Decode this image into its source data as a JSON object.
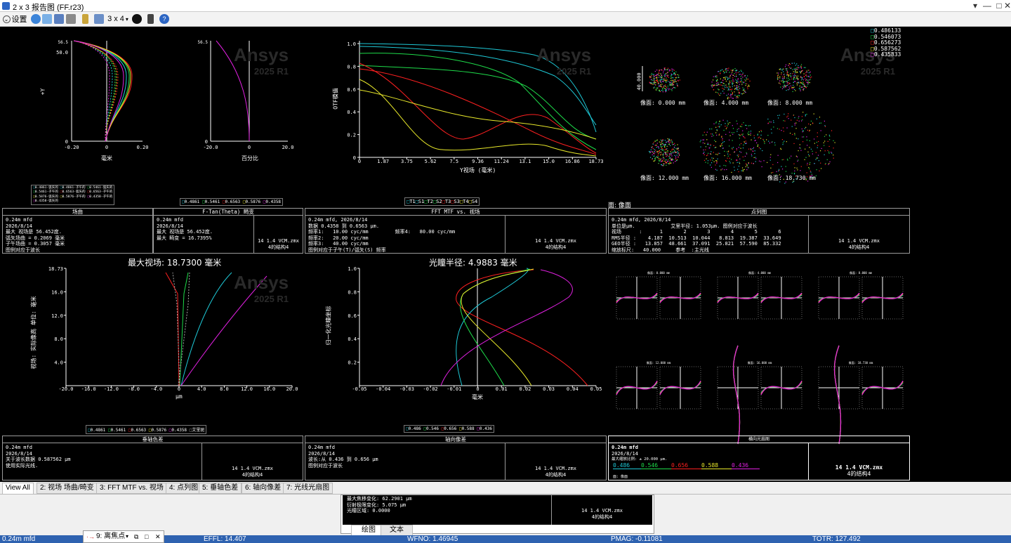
{
  "window": {
    "title": "2 x 3 报告图 (FF.r23)"
  },
  "toolbar": {
    "settings_label": "设置",
    "layout_label": "3 x 4"
  },
  "watermark": {
    "brand": "Ansys",
    "version": "2025 R1"
  },
  "chart_data": [
    {
      "type": "line",
      "title": "场曲",
      "xlabel": "毫米",
      "ylabel": "+Y",
      "x_ticks": [
        "-0.20",
        "0",
        "0.20"
      ],
      "y_ticks": [
        "0",
        "50.0",
        "56.5"
      ],
      "xlim": [
        -0.2,
        0.2
      ],
      "ylim": [
        0,
        56.5
      ],
      "series": [
        {
          "name": "0.4861-弧矢的",
          "color": "#1ec8d6"
        },
        {
          "name": "0.4861-子午的",
          "color": "#1ec8d6"
        },
        {
          "name": "0.5461-弧矢的",
          "color": "#1edc4a"
        },
        {
          "name": "0.5461-子午的",
          "color": "#1edc4a"
        },
        {
          "name": "0.6563-弧矢的",
          "color": "#ff2020"
        },
        {
          "name": "0.6563-子午的",
          "color": "#ff2020"
        },
        {
          "name": "0.5876-弧矢的",
          "color": "#e8e82a"
        },
        {
          "name": "0.5876-子午的",
          "color": "#e8e82a"
        },
        {
          "name": "0.4358-弧矢的",
          "color": "#e020e0"
        },
        {
          "name": "0.4358-子午的",
          "color": "#e020e0"
        }
      ]
    },
    {
      "type": "line",
      "title": "F-Tan(Theta) 畸变",
      "xlabel": "百分比",
      "x_ticks": [
        "-20.0",
        "0",
        "20.0"
      ],
      "y_ticks": [
        "0",
        "56.5"
      ],
      "xlim": [
        -20,
        20
      ],
      "ylim": [
        0,
        56.5
      ],
      "legend": [
        "0.4861",
        "0.5461",
        "0.6563",
        "0.5876",
        "0.4358"
      ]
    },
    {
      "type": "line",
      "title": "FFT MTF vs. 视场",
      "xlabel": "Y视场 (毫米)",
      "ylabel": "OTF模值",
      "x_ticks": [
        "0",
        "1.87",
        "3.75",
        "5.62",
        "7.5",
        "9.36",
        "11.24",
        "13.1",
        "15.0",
        "16.86",
        "18.73"
      ],
      "y_ticks": [
        "0",
        "0.2",
        "0.4",
        "0.6",
        "0.8",
        "1.0"
      ],
      "xlim": [
        0,
        18.73
      ],
      "ylim": [
        0,
        1.0
      ],
      "legend": [
        "T1",
        "S1",
        "T2",
        "S2",
        "T3",
        "S3",
        "T4",
        "S4"
      ]
    },
    {
      "type": "scatter",
      "title": "点列图",
      "wavelength_legend": [
        "0.486133",
        "0.546073",
        "0.656273",
        "0.587562",
        "0.435833"
      ],
      "scale_label": "40.000",
      "fields": [
        "像面: 0.000 mm",
        "像面: 4.000 mm",
        "像面: 8.000 mm",
        "像面: 12.000 mm",
        "像面: 16.000 mm",
        "像面: 18.730 mm"
      ]
    },
    {
      "type": "line",
      "title": "最大视场: 18.7300 毫米",
      "xlabel": "μm",
      "ylabel": "视场: 实际像高  单位: 毫米",
      "x_ticks": [
        "-20.0",
        "-16.0",
        "-12.0",
        "-8.0",
        "-4.0",
        "0",
        "4.0",
        "8.0",
        "12.0",
        "16.0",
        "20.0"
      ],
      "y_ticks": [
        "4.0",
        "8.0",
        "12.0",
        "16.0",
        "18.73"
      ],
      "xlim": [
        -20,
        20
      ],
      "ylim": [
        0,
        18.73
      ],
      "legend": [
        "0.4861",
        "0.5461",
        "0.6563",
        "0.5876",
        "0.4358",
        "艾里斑"
      ]
    },
    {
      "type": "line",
      "title": "光瞳半径: 4.9883 毫米",
      "xlabel": "毫米",
      "ylabel": "归一化光瞳坐标",
      "x_ticks": [
        "-0.05",
        "-0.04",
        "-0.03",
        "-0.02",
        "-0.01",
        "0",
        "0.01",
        "0.02",
        "0.03",
        "0.04",
        "0.05"
      ],
      "y_ticks": [
        "0.2",
        "0.4",
        "0.6",
        "0.8",
        "1.0"
      ],
      "xlim": [
        -0.05,
        0.05
      ],
      "ylim": [
        0,
        1.0
      ],
      "legend": [
        "0.486",
        "0.546",
        "0.656",
        "0.588",
        "0.436"
      ]
    }
  ],
  "panels": {
    "field_curvature": {
      "title": "场曲",
      "lines": [
        "0.24m mfd",
        "2026/8/14",
        "最大 视场是 56.452度.",
        "弧矢场曲 = 0.2069 毫米",
        "子午场曲 = 0.3057 毫米",
        "图例对应于波长"
      ]
    },
    "distortion": {
      "title": "F-Tan(Theta) 畸变",
      "lines": [
        "0.24m mfd",
        "2026/8/14",
        "最大 视场是 56.452度.",
        "最大 畸变 = 16.7395%"
      ],
      "file": "14 1.4 VCM.zmx",
      "config": "4的结构4"
    },
    "mtf": {
      "title": "FFT MTF vs. 视场",
      "lines": [
        "0.24m mfd, 2026/8/14",
        "数据 0.4358 到 0.6563 μm.",
        "频率1:   10.00 cyc/mm         频率4:   80.00 cyc/mm",
        "频率2:   20.00 cyc/mm",
        "频率3:   40.00 cyc/mm",
        "图例对应于子午(T)/弧矢(S) 频率"
      ],
      "file": "14 1.4 VCM.zmx",
      "config": "4的结构4"
    },
    "spot": {
      "heading": "面: 像面",
      "title": "点列图",
      "lines": [
        "0.24m mfd, 2026/8/14",
        "单位是μm.            艾里半径: 1.053μm. 图例对应于波长",
        "视场      :      1       2       3       4       5       6",
        "RMS半径 :    4.187  10.513  10.044   8.813  19.387  33.649",
        "GEO半径 :   13.857  48.661  37.091  25.821  57.590  85.332",
        "缩放标尺:   40.000     参考  :主光线"
      ],
      "file": "14 1.4 VCM.zmx",
      "config": "4的结构4"
    },
    "lateral_color": {
      "title": "垂轴色差",
      "lines": [
        "0.24m mfd",
        "2026/8/14",
        "关于波长数据 0.587562 μm",
        "使用实际光线."
      ],
      "file": "14 1.4 VCM.zmx",
      "config": "4的结构4"
    },
    "axial": {
      "title": "轴向像差",
      "lines": [
        "0.24m mfd",
        "2026/8/14",
        "波长:从 0.436 到 0.656 μm",
        "图例对应于波长"
      ],
      "file": "14 1.4 VCM.zmx",
      "config": "4的结构4"
    },
    "ray_fan": {
      "title": "横向光扇图",
      "lines": [
        "0.24m mfd",
        "2026/8/14",
        "最大缩放比例: ± 20.000 μm."
      ],
      "waves": [
        "0.486",
        "0.546",
        "0.656",
        "0.588",
        "0.436"
      ],
      "surface": "面: 像面",
      "file": "14 1.4 VCM.zmx",
      "config": "4的结构4",
      "field_titles": [
        "像面: 0.000 mm",
        "像面: 4.000 mm",
        "像面: 8.000 mm",
        "像面: 12.000 mm",
        "像面: 16.000 mm",
        "像面: 18.730 mm"
      ]
    }
  },
  "tabs": [
    "View All",
    "2: 视场 场曲/畸变",
    "3: FFT MTF vs. 视场",
    "4: 点列图",
    "5: 垂轴色差",
    "6: 轴向像差",
    "7: 光线光扇图"
  ],
  "subwindow": {
    "lines": [
      "最大焦移变化: 62.2901 μm",
      "衍射极限变化: 5.075 μm",
      "光瞳区域: 0.0000"
    ],
    "file": "14 1.4 VCM.zmx",
    "config": "4的结构4",
    "tabs": [
      "绘图",
      "文本"
    ]
  },
  "floating_window": {
    "title": "9: 离焦点"
  },
  "statusbar": {
    "item1": "0.24m mfd",
    "item2": "EFFL: 14.407",
    "item3": "WFNO: 1.46945",
    "item4": "PMAG: -0.11081",
    "item5": "TOTR: 127.492"
  },
  "colors": {
    "blue": "#1ec8d6",
    "green": "#1edc4a",
    "red": "#ff2020",
    "yellow": "#e8e82a",
    "magenta": "#e020e0"
  }
}
